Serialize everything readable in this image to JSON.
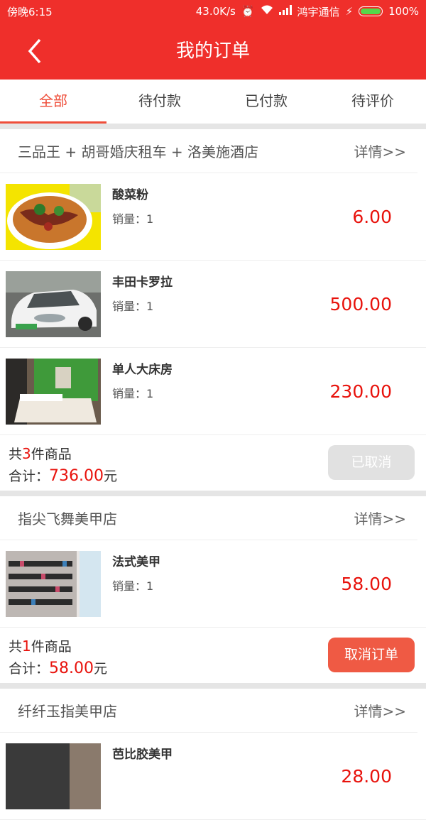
{
  "status_bar": {
    "time": "傍晚6:15",
    "network_speed": "43.0K/s",
    "carrier": "鸿宇通信",
    "battery": "100%"
  },
  "navbar": {
    "title": "我的订单",
    "back_icon": "chevron-left-icon"
  },
  "tabs": [
    {
      "label": "全部",
      "active": true
    },
    {
      "label": "待付款",
      "active": false
    },
    {
      "label": "已付款",
      "active": false
    },
    {
      "label": "待评价",
      "active": false
    }
  ],
  "orders": [
    {
      "store": "三品王 + 胡哥婚庆租车 + 洛美施酒店",
      "detail_label": "详情>>",
      "items": [
        {
          "name": "酸菜粉",
          "qty_label": "销量：",
          "qty": "1",
          "price": "6.00"
        },
        {
          "name": "丰田卡罗拉",
          "qty_label": "销量：",
          "qty": "1",
          "price": "500.00"
        },
        {
          "name": "单人大床房",
          "qty_label": "销量：",
          "qty": "1",
          "price": "230.00"
        }
      ],
      "count_prefix": "共",
      "count": "3",
      "count_suffix": "件商品",
      "total_prefix": "合计：",
      "total": "736.00",
      "total_suffix": "元",
      "button": "已取消"
    },
    {
      "store": "指尖飞舞美甲店",
      "detail_label": "详情>>",
      "items": [
        {
          "name": "法式美甲",
          "qty_label": "销量：",
          "qty": "1",
          "price": "58.00"
        }
      ],
      "count_prefix": "共",
      "count": "1",
      "count_suffix": "件商品",
      "total_prefix": "合计：",
      "total": "58.00",
      "total_suffix": "元",
      "button": "取消订单"
    },
    {
      "store": "纤纤玉指美甲店",
      "detail_label": "详情>>",
      "items": [
        {
          "name": "芭比胶美甲",
          "price": "28.00"
        }
      ]
    }
  ],
  "colors": {
    "accent": "#ef2f2b",
    "price": "#e8120c",
    "tab_active": "#ef4e3a"
  }
}
